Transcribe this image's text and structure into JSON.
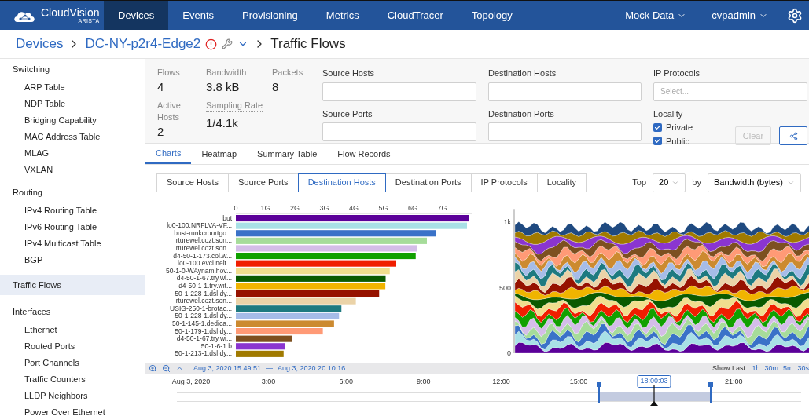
{
  "nav": {
    "logo": "CloudVision",
    "logo_sub": "ARISTA",
    "items": [
      {
        "label": "Devices",
        "selected": true
      },
      {
        "label": "Events",
        "selected": false
      },
      {
        "label": "Provisioning",
        "selected": false
      },
      {
        "label": "Metrics",
        "selected": false
      },
      {
        "label": "CloudTracer",
        "selected": false
      },
      {
        "label": "Topology",
        "selected": false
      }
    ],
    "menus": [
      "Mock Data",
      "cvpadmin"
    ]
  },
  "breadcrumb": {
    "root": "Devices",
    "device": "DC-NY-p2r4-Edge2",
    "page": "Traffic Flows"
  },
  "sidebar": [
    {
      "kind": "section",
      "label": "Switching",
      "selected": false,
      "children": [
        {
          "label": "ARP Table"
        },
        {
          "label": "NDP Table"
        },
        {
          "label": "Bridging Capability"
        },
        {
          "label": "MAC Address Table"
        },
        {
          "label": "MLAG"
        },
        {
          "label": "VXLAN"
        }
      ]
    },
    {
      "kind": "section",
      "label": "Routing",
      "selected": false,
      "children": [
        {
          "label": "IPv4 Routing Table"
        },
        {
          "label": "IPv6 Routing Table"
        },
        {
          "label": "IPv4 Multicast Table"
        },
        {
          "label": "BGP"
        }
      ]
    },
    {
      "kind": "link",
      "label": "Traffic Flows",
      "selected": true
    },
    {
      "kind": "section",
      "label": "Interfaces",
      "selected": false,
      "children": [
        {
          "label": "Ethernet"
        },
        {
          "label": "Routed Ports"
        },
        {
          "label": "Port Channels"
        },
        {
          "label": "Traffic Counters"
        },
        {
          "label": "LLDP Neighbors"
        },
        {
          "label": "Power Over Ethernet"
        }
      ]
    }
  ],
  "stats": {
    "flows": {
      "label": "Flows",
      "value": "4"
    },
    "bandwidth": {
      "label": "Bandwidth",
      "value": "3.8 kB"
    },
    "packets": {
      "label": "Packets",
      "value": "8"
    },
    "active_hosts": {
      "label": "Active Hosts",
      "value": "2"
    },
    "sampling_rate": {
      "label": "Sampling Rate",
      "value": "1/4.1k"
    }
  },
  "filters": {
    "source_hosts": "Source Hosts",
    "destination_hosts": "Destination Hosts",
    "ip_protocols": {
      "label": "IP Protocols",
      "placeholder": "Select..."
    },
    "source_ports": "Source Ports",
    "destination_ports": "Destination Ports",
    "locality": {
      "label": "Locality",
      "options": [
        {
          "label": "Private",
          "checked": true
        },
        {
          "label": "Public",
          "checked": true
        }
      ]
    },
    "clear": {
      "label": "Clear",
      "disabled": true
    }
  },
  "tabs": [
    {
      "label": "Charts",
      "selected": true
    },
    {
      "label": "Heatmap",
      "selected": false
    },
    {
      "label": "Summary Table",
      "selected": false
    },
    {
      "label": "Flow Records",
      "selected": false
    }
  ],
  "groupings": [
    {
      "label": "Source Hosts",
      "selected": false
    },
    {
      "label": "Source Ports",
      "selected": false
    },
    {
      "label": "Destination Hosts",
      "selected": true
    },
    {
      "label": "Destination Ports",
      "selected": false
    },
    {
      "label": "IP Protocols",
      "selected": false
    },
    {
      "label": "Locality",
      "selected": false
    }
  ],
  "top": {
    "label": "Top",
    "value": "20",
    "by_label": "by",
    "by_value": "Bandwidth (bytes)"
  },
  "bar_chart": {
    "chart_data": {
      "type": "bar",
      "orientation": "horizontal",
      "categories": [
        "but",
        "lo0-100.NRFLVA-VF...",
        "bust-runkcrourtgo...",
        "rturewel.cozt.son...",
        "rturewel.cozt.son...",
        "d4-50-1-173.col.w...",
        "lo0-100.evci.nelt...",
        "50-1-0-WAynam.hov...",
        "d4-50-1-67.try.wi...",
        "d4-50-1-1.try.wit...",
        "50-1-228-1.dsl.dy...",
        "rturewel.cozt.son...",
        "USIG-250-1-brotac...",
        "50-1-228-1.dsl.dy...",
        "50-1-145-1.dedica...",
        "50-1-179-1.dsl.dy...",
        "d4-50-1-67.try.wi...",
        "50-1-6-1.b",
        "50-1-213-1.dsl.dy..."
      ],
      "series": [
        {
          "colors": [
            "#5b0099",
            "#a8e0e6",
            "#3a72c8",
            "#a6dc9a",
            "#d4bde8",
            "#11a000",
            "#f01e00",
            "#f0de8e",
            "#0a5a00",
            "#f0b400",
            "#961200",
            "#ebd3a8",
            "#1e7a80",
            "#a6bce8",
            "#cc8a30",
            "#ff9a76",
            "#7d5020",
            "#8a35d0",
            "#a07a00"
          ],
          "values": [
            7.9,
            7.84,
            6.78,
            6.48,
            6.16,
            6.1,
            5.44,
            5.22,
            5.08,
            5.07,
            4.86,
            4.07,
            3.58,
            3.5,
            3.33,
            2.95,
            1.91,
            1.66,
            1.62
          ]
        }
      ],
      "xlim": [
        0,
        8
      ],
      "xticks": [
        {
          "value": 0,
          "label": "0"
        },
        {
          "value": 1,
          "label": "1G"
        },
        {
          "value": 2,
          "label": "2G"
        },
        {
          "value": 3,
          "label": "3G"
        },
        {
          "value": 4,
          "label": "4G"
        },
        {
          "value": 5,
          "label": "5G"
        },
        {
          "value": 6,
          "label": "6G"
        },
        {
          "value": 7,
          "label": "7G"
        }
      ]
    }
  },
  "area_chart": {
    "y_axis_labels": [
      "1k",
      "500",
      "0"
    ]
  },
  "timeline": {
    "range_start": "Aug 3, 2020 15:49:51",
    "range_sep": "—",
    "range_end": "Aug 3, 2020 20:10:16",
    "show_last": "Show Last:",
    "presets": [
      "1h",
      "30m",
      "5m",
      "30s"
    ],
    "ticks": [
      "Aug 3, 2020",
      "3:00",
      "6:00",
      "9:00",
      "12:00",
      "15:00",
      "21:00"
    ],
    "cursor": "18:00:03"
  }
}
